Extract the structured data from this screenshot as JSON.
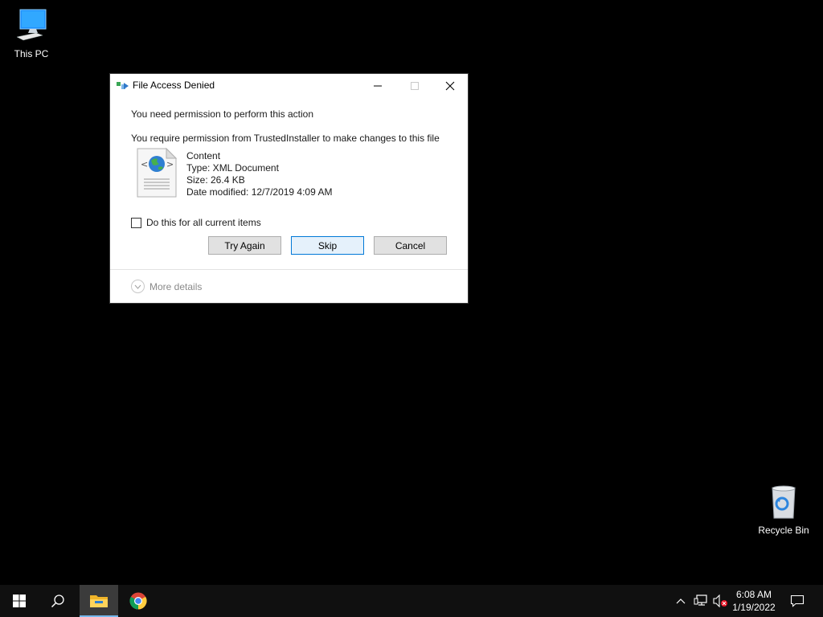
{
  "desktop": {
    "icons": [
      {
        "label": "This PC"
      },
      {
        "label": "Recycle Bin"
      }
    ]
  },
  "dialog": {
    "title": "File Access Denied",
    "message": "You need permission to perform this action",
    "detail": "You require permission from TrustedInstaller to make changes to this file",
    "file": {
      "name": "Content",
      "type": "Type: XML Document",
      "size": "Size: 26.4 KB",
      "modified": "Date modified: 12/7/2019 4:09 AM"
    },
    "checkbox_label": "Do this for all current items",
    "checkbox_checked": false,
    "buttons": {
      "try_again": "Try Again",
      "skip": "Skip",
      "cancel": "Cancel"
    },
    "more_details": "More details"
  },
  "taskbar": {
    "pinned": [
      "start-icon",
      "search-icon",
      "file-explorer-icon",
      "chrome-icon"
    ],
    "clock": {
      "time": "6:08 AM",
      "date": "1/19/2022"
    },
    "accent_color": "#76b9ed"
  }
}
